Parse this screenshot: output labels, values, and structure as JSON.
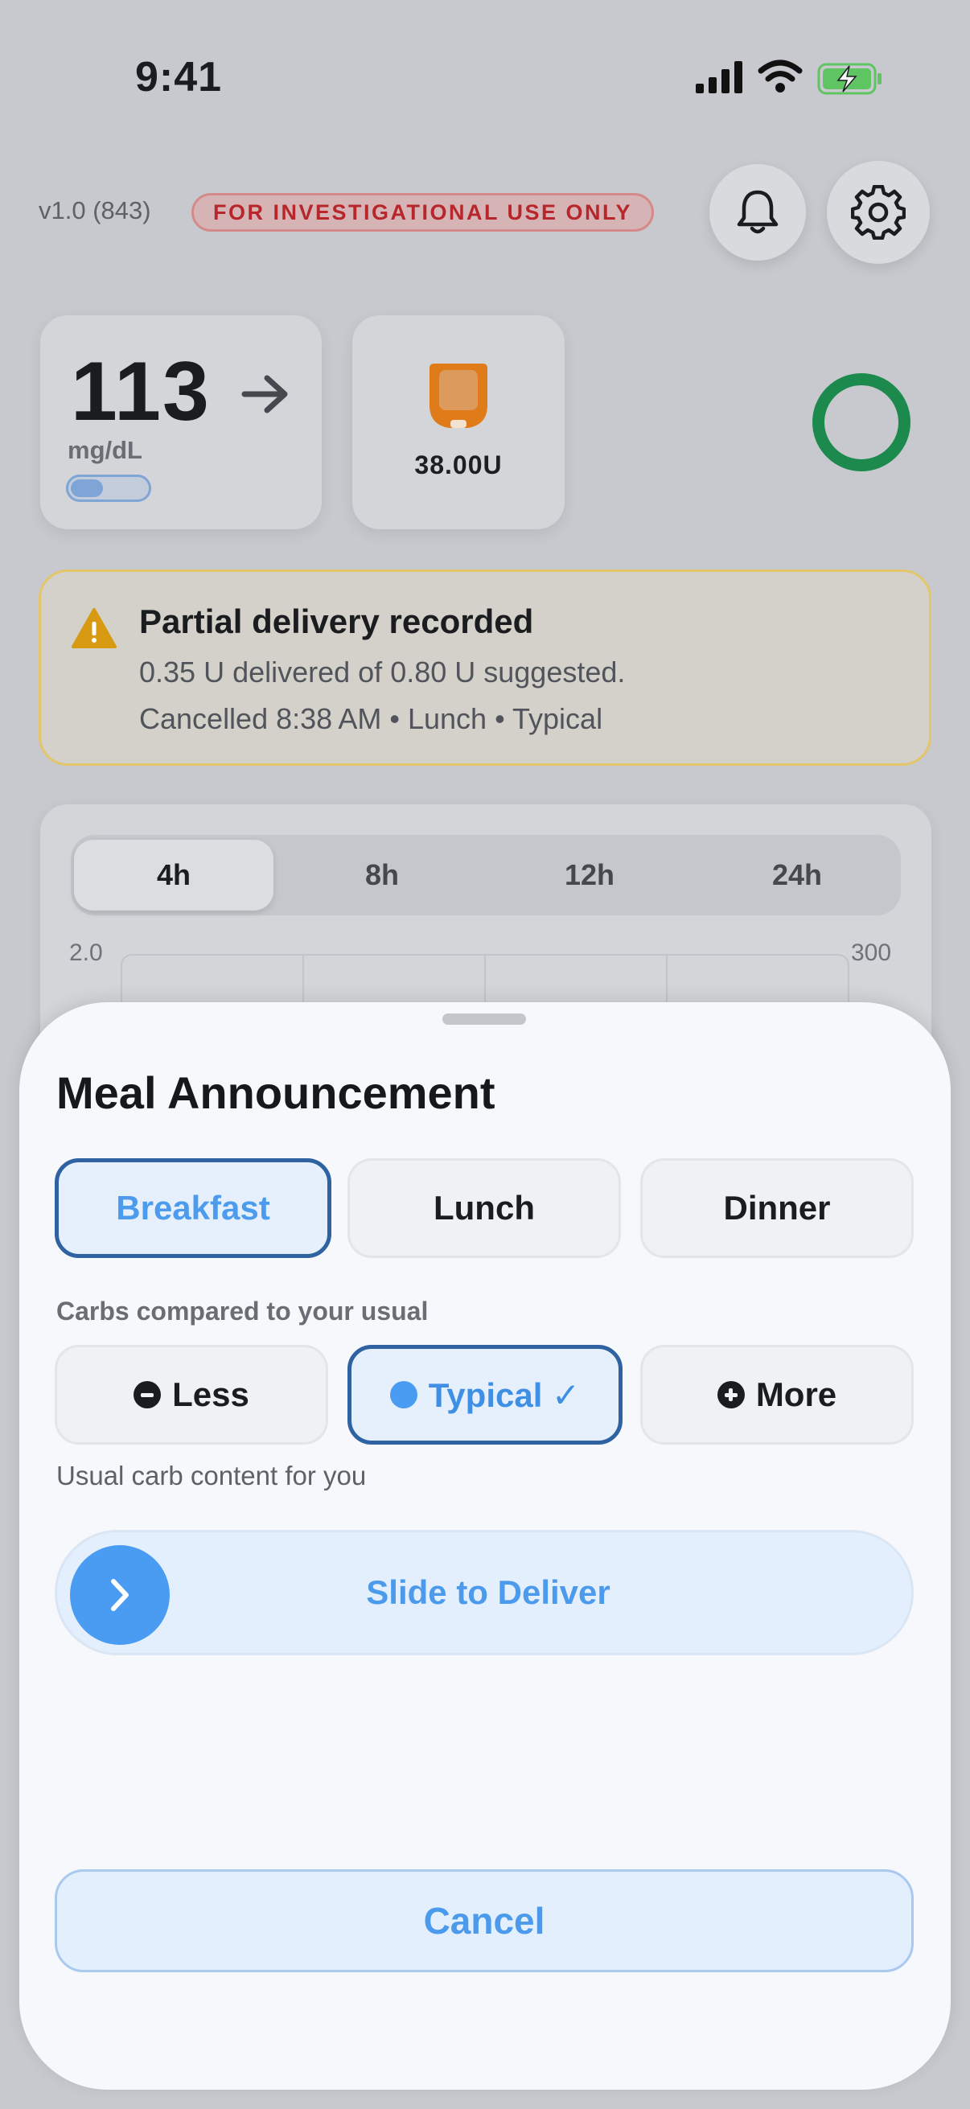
{
  "status_bar": {
    "time": "9:41"
  },
  "header": {
    "version": "v1.0 (843)",
    "badge": "FOR INVESTIGATIONAL USE ONLY"
  },
  "glucose": {
    "value": "113",
    "unit": "mg/dL",
    "trend_icon": "arrow-right-icon"
  },
  "pod": {
    "reservoir": "38.00U",
    "icon": "pod-icon"
  },
  "loop_status": {
    "color": "#1c8a4c"
  },
  "alert": {
    "title": "Partial delivery recorded",
    "line1": "0.35 U delivered of 0.80 U suggested.",
    "line2": "Cancelled 8:38 AM • Lunch • Typical"
  },
  "chart": {
    "ranges": [
      "4h",
      "8h",
      "12h",
      "24h"
    ],
    "selected_range": "4h",
    "axis_left_top": "2.0",
    "axis_right_top": "300"
  },
  "sheet": {
    "title": "Meal Announcement",
    "meals": [
      "Breakfast",
      "Lunch",
      "Dinner"
    ],
    "selected_meal": "Breakfast",
    "carb_label": "Carbs compared to your usual",
    "carb_options": {
      "less": "Less",
      "typical": "Typical ✓",
      "more": "More"
    },
    "selected_carb": "Typical",
    "carb_hint": "Usual carb content for you",
    "slide_label": "Slide to Deliver",
    "cancel_label": "Cancel"
  },
  "colors": {
    "accent": "#4b9aec",
    "selected_border": "#2e62a1",
    "alert_border": "#e3c56a",
    "badge_text": "#b6262a"
  }
}
